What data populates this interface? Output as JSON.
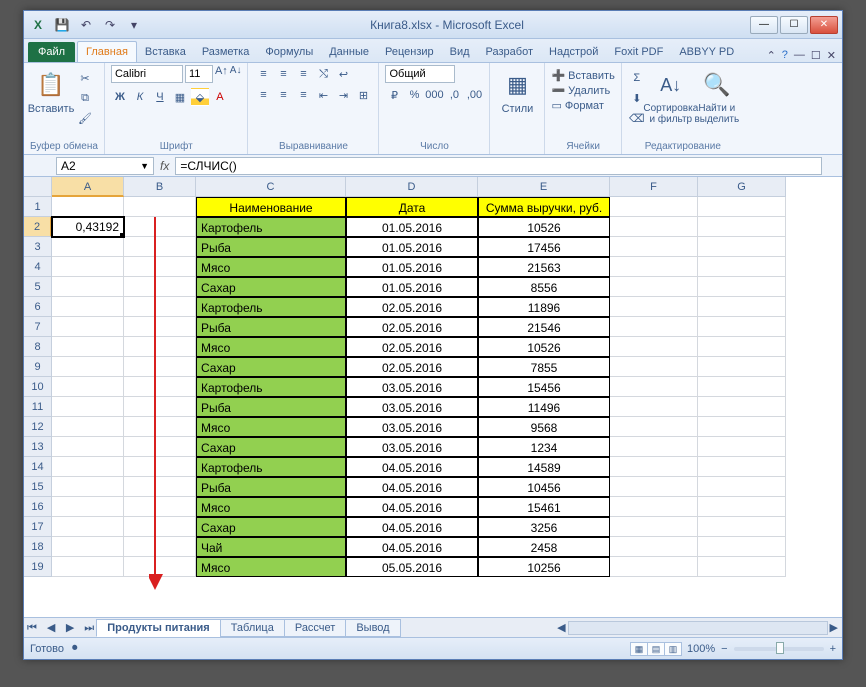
{
  "titlebar": {
    "title": "Книга8.xlsx  -  Microsoft Excel"
  },
  "tabs": {
    "file": "Файл",
    "list": [
      "Главная",
      "Вставка",
      "Разметка",
      "Формулы",
      "Данные",
      "Рецензир",
      "Вид",
      "Разработ",
      "Надстрой",
      "Foxit PDF",
      "ABBYY PD"
    ],
    "active_index": 0
  },
  "ribbon": {
    "clipboard": {
      "paste": "Вставить",
      "label": "Буфер обмена"
    },
    "font": {
      "name": "Calibri",
      "size": "11",
      "label": "Шрифт"
    },
    "align": {
      "label": "Выравнивание"
    },
    "number": {
      "format": "Общий",
      "label": "Число"
    },
    "styles": {
      "btn": "Стили",
      "label": ""
    },
    "cells": {
      "insert": "Вставить",
      "delete": "Удалить",
      "format": "Формат",
      "label": "Ячейки"
    },
    "editing": {
      "sort": "Сортировка и фильтр",
      "find": "Найти и выделить",
      "label": "Редактирование"
    }
  },
  "fxbar": {
    "namebox": "A2",
    "formula": "=СЛЧИС()"
  },
  "grid": {
    "col_headers": [
      "A",
      "B",
      "C",
      "D",
      "E",
      "F",
      "G"
    ],
    "active_cell": "0,43192",
    "headers": [
      "Наименование",
      "Дата",
      "Сумма выручки, руб."
    ],
    "rows": [
      {
        "name": "Картофель",
        "date": "01.05.2016",
        "sum": "10526"
      },
      {
        "name": "Рыба",
        "date": "01.05.2016",
        "sum": "17456"
      },
      {
        "name": "Мясо",
        "date": "01.05.2016",
        "sum": "21563"
      },
      {
        "name": "Сахар",
        "date": "01.05.2016",
        "sum": "8556"
      },
      {
        "name": "Картофель",
        "date": "02.05.2016",
        "sum": "11896"
      },
      {
        "name": "Рыба",
        "date": "02.05.2016",
        "sum": "21546"
      },
      {
        "name": "Мясо",
        "date": "02.05.2016",
        "sum": "10526"
      },
      {
        "name": "Сахар",
        "date": "02.05.2016",
        "sum": "7855"
      },
      {
        "name": "Картофель",
        "date": "03.05.2016",
        "sum": "15456"
      },
      {
        "name": "Рыба",
        "date": "03.05.2016",
        "sum": "11496"
      },
      {
        "name": "Мясо",
        "date": "03.05.2016",
        "sum": "9568"
      },
      {
        "name": "Сахар",
        "date": "03.05.2016",
        "sum": "1234"
      },
      {
        "name": "Картофель",
        "date": "04.05.2016",
        "sum": "14589"
      },
      {
        "name": "Рыба",
        "date": "04.05.2016",
        "sum": "10456"
      },
      {
        "name": "Мясо",
        "date": "04.05.2016",
        "sum": "15461"
      },
      {
        "name": "Сахар",
        "date": "04.05.2016",
        "sum": "3256"
      },
      {
        "name": "Чай",
        "date": "04.05.2016",
        "sum": "2458"
      },
      {
        "name": "Мясо",
        "date": "05.05.2016",
        "sum": "10256"
      }
    ]
  },
  "sheets": {
    "list": [
      "Продукты питания",
      "Таблица",
      "Рассчет",
      "Вывод"
    ],
    "active_index": 0
  },
  "status": {
    "ready": "Готово",
    "zoom": "100%"
  }
}
